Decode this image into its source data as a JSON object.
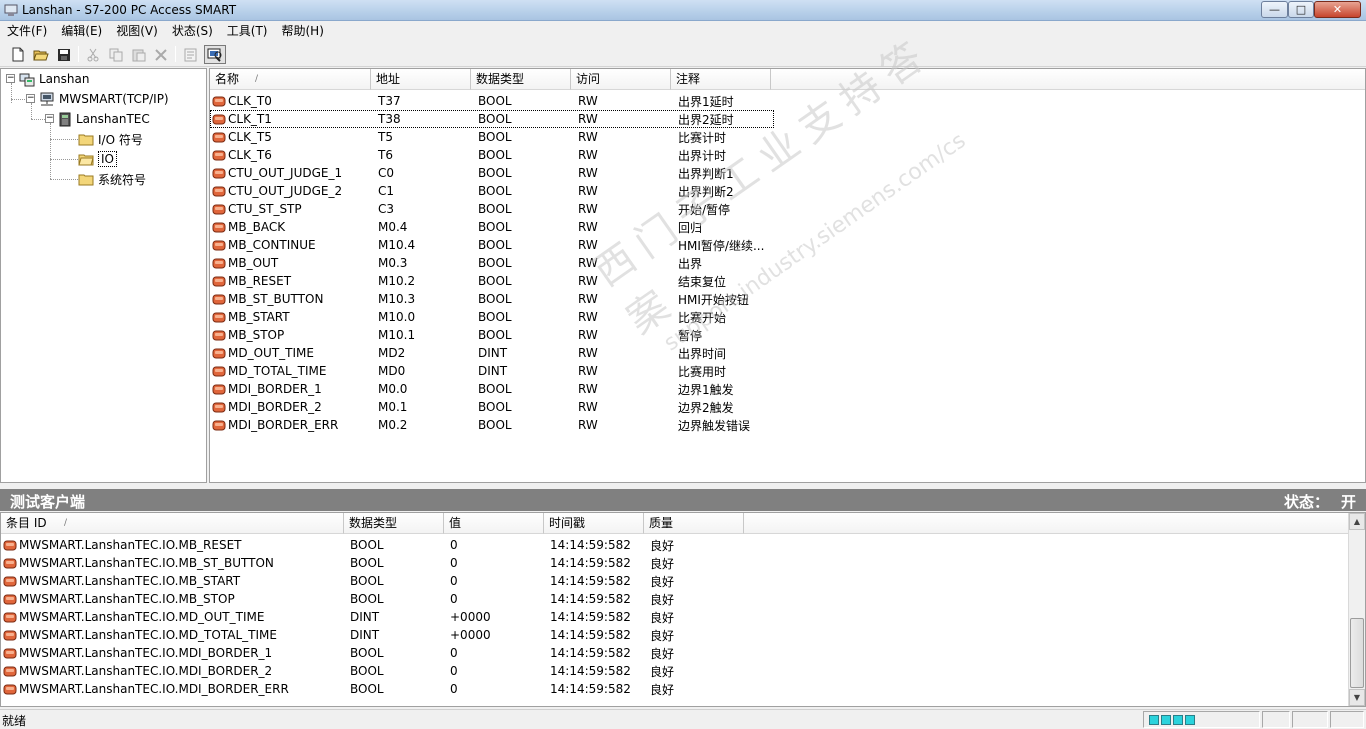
{
  "window": {
    "title": "Lanshan - S7-200 PC Access SMART",
    "controls": {
      "minimize": "—",
      "maximize": "□",
      "close": "✕"
    }
  },
  "menu": [
    "文件(F)",
    "编辑(E)",
    "视图(V)",
    "状态(S)",
    "工具(T)",
    "帮助(H)"
  ],
  "toolbar": [
    "new-file-icon",
    "open-folder-icon",
    "save-icon",
    "cut-icon",
    "copy-icon",
    "paste-icon",
    "delete-icon",
    "properties-icon",
    "test-client-icon"
  ],
  "tree": {
    "root": "Lanshan",
    "plc_conn": "MWSMART(TCP/IP)",
    "plc": "LanshanTEC",
    "folders": [
      "I/O 符号",
      "IO",
      "系统符号"
    ]
  },
  "symbols": {
    "columns": [
      "名称",
      "地址",
      "数据类型",
      "访问",
      "注释"
    ],
    "rows": [
      {
        "name": "CLK_T0",
        "addr": "T37",
        "type": "BOOL",
        "access": "RW",
        "comment": "出界1延时"
      },
      {
        "name": "CLK_T1",
        "addr": "T38",
        "type": "BOOL",
        "access": "RW",
        "comment": "出界2延时"
      },
      {
        "name": "CLK_T5",
        "addr": "T5",
        "type": "BOOL",
        "access": "RW",
        "comment": "比赛计时"
      },
      {
        "name": "CLK_T6",
        "addr": "T6",
        "type": "BOOL",
        "access": "RW",
        "comment": "出界计时"
      },
      {
        "name": "CTU_OUT_JUDGE_1",
        "addr": "C0",
        "type": "BOOL",
        "access": "RW",
        "comment": "出界判断1"
      },
      {
        "name": "CTU_OUT_JUDGE_2",
        "addr": "C1",
        "type": "BOOL",
        "access": "RW",
        "comment": "出界判断2"
      },
      {
        "name": "CTU_ST_STP",
        "addr": "C3",
        "type": "BOOL",
        "access": "RW",
        "comment": "开始/暂停"
      },
      {
        "name": "MB_BACK",
        "addr": "M0.4",
        "type": "BOOL",
        "access": "RW",
        "comment": "回归"
      },
      {
        "name": "MB_CONTINUE",
        "addr": "M10.4",
        "type": "BOOL",
        "access": "RW",
        "comment": "HMI暂停/继续..."
      },
      {
        "name": "MB_OUT",
        "addr": "M0.3",
        "type": "BOOL",
        "access": "RW",
        "comment": "出界"
      },
      {
        "name": "MB_RESET",
        "addr": "M10.2",
        "type": "BOOL",
        "access": "RW",
        "comment": "结束复位"
      },
      {
        "name": "MB_ST_BUTTON",
        "addr": "M10.3",
        "type": "BOOL",
        "access": "RW",
        "comment": "HMI开始按钮"
      },
      {
        "name": "MB_START",
        "addr": "M10.0",
        "type": "BOOL",
        "access": "RW",
        "comment": "比赛开始"
      },
      {
        "name": "MB_STOP",
        "addr": "M10.1",
        "type": "BOOL",
        "access": "RW",
        "comment": "暂停"
      },
      {
        "name": "MD_OUT_TIME",
        "addr": "MD2",
        "type": "DINT",
        "access": "RW",
        "comment": "出界时间"
      },
      {
        "name": "MD_TOTAL_TIME",
        "addr": "MD0",
        "type": "DINT",
        "access": "RW",
        "comment": "比赛用时"
      },
      {
        "name": "MDI_BORDER_1",
        "addr": "M0.0",
        "type": "BOOL",
        "access": "RW",
        "comment": "边界1触发"
      },
      {
        "name": "MDI_BORDER_2",
        "addr": "M0.1",
        "type": "BOOL",
        "access": "RW",
        "comment": "边界2触发"
      },
      {
        "name": "MDI_BORDER_ERR",
        "addr": "M0.2",
        "type": "BOOL",
        "access": "RW",
        "comment": "边界触发错误"
      }
    ]
  },
  "watermark": {
    "line1": "西门子工业支持答案",
    "line2": "support.industry.siemens.com/cs"
  },
  "client": {
    "title": "测试客户端",
    "status_label": "状态：",
    "status_value": "开",
    "columns": [
      "条目 ID",
      "数据类型",
      "值",
      "时间戳",
      "质量"
    ],
    "rows": [
      {
        "id": "MWSMART.LanshanTEC.IO.MB_RESET",
        "type": "BOOL",
        "value": "0",
        "time": "14:14:59:582",
        "quality": "良好"
      },
      {
        "id": "MWSMART.LanshanTEC.IO.MB_ST_BUTTON",
        "type": "BOOL",
        "value": "0",
        "time": "14:14:59:582",
        "quality": "良好"
      },
      {
        "id": "MWSMART.LanshanTEC.IO.MB_START",
        "type": "BOOL",
        "value": "0",
        "time": "14:14:59:582",
        "quality": "良好"
      },
      {
        "id": "MWSMART.LanshanTEC.IO.MB_STOP",
        "type": "BOOL",
        "value": "0",
        "time": "14:14:59:582",
        "quality": "良好"
      },
      {
        "id": "MWSMART.LanshanTEC.IO.MD_OUT_TIME",
        "type": "DINT",
        "value": "+0000",
        "time": "14:14:59:582",
        "quality": "良好"
      },
      {
        "id": "MWSMART.LanshanTEC.IO.MD_TOTAL_TIME",
        "type": "DINT",
        "value": "+0000",
        "time": "14:14:59:582",
        "quality": "良好"
      },
      {
        "id": "MWSMART.LanshanTEC.IO.MDI_BORDER_1",
        "type": "BOOL",
        "value": "0",
        "time": "14:14:59:582",
        "quality": "良好"
      },
      {
        "id": "MWSMART.LanshanTEC.IO.MDI_BORDER_2",
        "type": "BOOL",
        "value": "0",
        "time": "14:14:59:582",
        "quality": "良好"
      },
      {
        "id": "MWSMART.LanshanTEC.IO.MDI_BORDER_ERR",
        "type": "BOOL",
        "value": "0",
        "time": "14:14:59:582",
        "quality": "良好"
      }
    ]
  },
  "statusbar": {
    "text": "就绪"
  }
}
